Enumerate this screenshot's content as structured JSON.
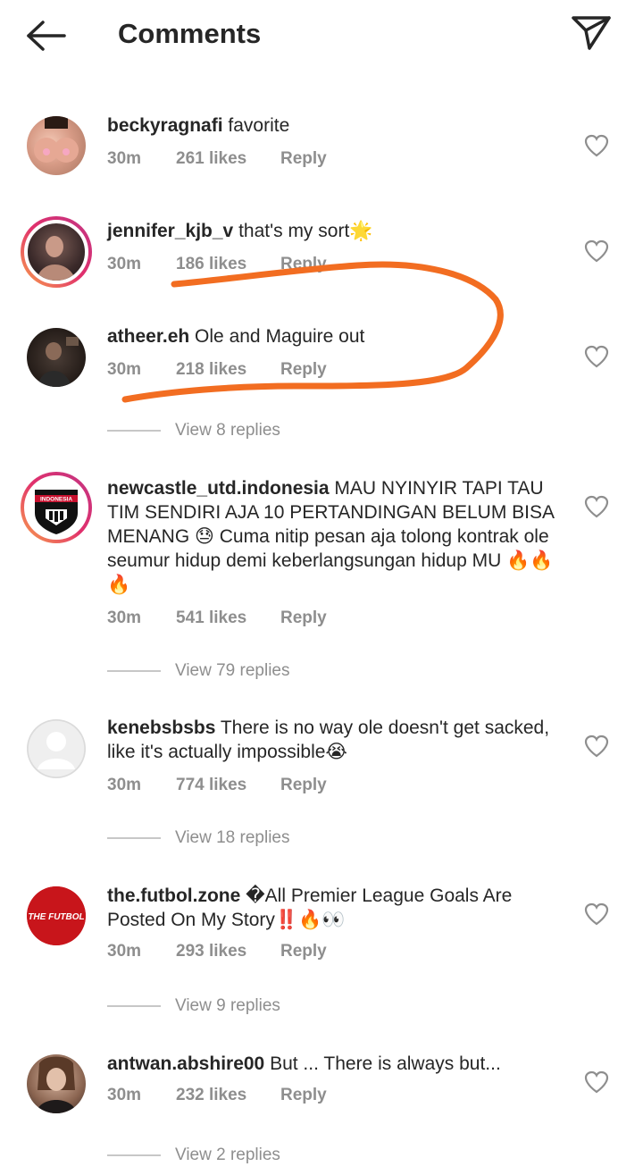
{
  "header": {
    "title": "Comments"
  },
  "comments": [
    {
      "username": "beckyragnafi",
      "text": " favorite",
      "time": "30m",
      "likes": "261 likes",
      "reply": "Reply"
    },
    {
      "username": "jennifer_kjb_v",
      "text": " that's my sort🌟",
      "time": "30m",
      "likes": "186 likes",
      "reply": "Reply"
    },
    {
      "username": "atheer.eh",
      "text": " Ole and Maguire out",
      "time": "30m",
      "likes": "218 likes",
      "reply": "Reply",
      "view_replies": "View 8 replies"
    },
    {
      "username": "newcastle_utd.indonesia",
      "text": " MAU NYINYIR TAPI TAU TIM SENDIRI AJA 10 PERTANDINGAN BELUM BISA MENANG 😓 Cuma nitip pesan aja tolong kontrak ole seumur hidup demi keberlangsungan hidup MU 🔥🔥🔥",
      "time": "30m",
      "likes": "541 likes",
      "reply": "Reply",
      "view_replies": "View 79 replies",
      "avatar_text": "INDONESIA"
    },
    {
      "username": "kenebsbsbs",
      "text": " There is no way ole doesn't get sacked, like it's actually impossible😭",
      "time": "30m",
      "likes": "774 likes",
      "reply": "Reply",
      "view_replies": "View 18 replies"
    },
    {
      "username": "the.futbol.zone",
      "text": " �All Premier League Goals Are Posted On My Story‼️🔥👀",
      "time": "30m",
      "likes": "293 likes",
      "reply": "Reply",
      "view_replies": "View 9 replies",
      "avatar_text": "THE FUTBOL"
    },
    {
      "username": "antwan.abshire00",
      "text": " But ... There is always but...",
      "time": "30m",
      "likes": "232 likes",
      "reply": "Reply",
      "view_replies": "View 2 replies"
    }
  ],
  "colors": {
    "text": "#262626",
    "muted": "#8e8e8e",
    "annotation": "#f26d21"
  },
  "icons": [
    "back-arrow-icon",
    "send-icon",
    "heart-icon"
  ]
}
